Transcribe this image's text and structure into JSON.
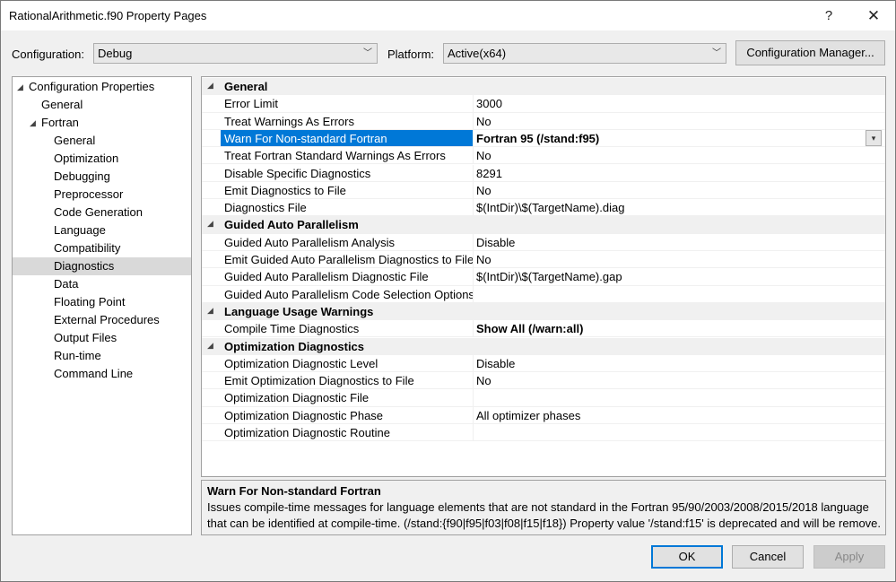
{
  "window": {
    "title": "RationalArithmetic.f90 Property Pages",
    "help_glyph": "?",
    "close_glyph": "✕"
  },
  "config": {
    "configuration_label": "Configuration:",
    "configuration_value": "Debug",
    "platform_label": "Platform:",
    "platform_value": "Active(x64)",
    "manager_button": "Configuration Manager..."
  },
  "tree": [
    {
      "label": "Configuration Properties",
      "toggle": "◢"
    },
    {
      "label": "General"
    },
    {
      "label": "Fortran",
      "toggle": "◢"
    },
    {
      "label": "General"
    },
    {
      "label": "Optimization"
    },
    {
      "label": "Debugging"
    },
    {
      "label": "Preprocessor"
    },
    {
      "label": "Code Generation"
    },
    {
      "label": "Language"
    },
    {
      "label": "Compatibility"
    },
    {
      "label": "Diagnostics",
      "selected": true
    },
    {
      "label": "Data"
    },
    {
      "label": "Floating Point"
    },
    {
      "label": "External Procedures"
    },
    {
      "label": "Output Files"
    },
    {
      "label": "Run-time"
    },
    {
      "label": "Command Line"
    }
  ],
  "grid": {
    "category_toggle": "◢",
    "dropdown_glyph": "▾",
    "categories": [
      {
        "name": "General",
        "props": [
          {
            "name": "Error Limit",
            "value": "3000"
          },
          {
            "name": "Treat Warnings As Errors",
            "value": "No"
          },
          {
            "name": "Warn For Non-standard Fortran",
            "value": "Fortran 95 (/stand:f95)",
            "selected": true
          },
          {
            "name": "Treat Fortran Standard Warnings As Errors",
            "value": "No"
          },
          {
            "name": "Disable Specific Diagnostics",
            "value": "8291"
          },
          {
            "name": "Emit Diagnostics to File",
            "value": "No"
          },
          {
            "name": "Diagnostics File",
            "value": "$(IntDir)\\$(TargetName).diag"
          }
        ]
      },
      {
        "name": "Guided Auto Parallelism",
        "props": [
          {
            "name": "Guided Auto Parallelism Analysis",
            "value": "Disable"
          },
          {
            "name": "Emit Guided Auto Parallelism Diagnostics to File",
            "value": "No"
          },
          {
            "name": "Guided Auto Parallelism Diagnostic File",
            "value": "$(IntDir)\\$(TargetName).gap"
          },
          {
            "name": "Guided Auto Parallelism Code Selection Options",
            "value": ""
          }
        ]
      },
      {
        "name": "Language Usage Warnings",
        "props": [
          {
            "name": "Compile Time Diagnostics",
            "value": "Show All (/warn:all)",
            "bold": true
          }
        ]
      },
      {
        "name": "Optimization Diagnostics",
        "props": [
          {
            "name": "Optimization Diagnostic Level",
            "value": "Disable"
          },
          {
            "name": "Emit Optimization Diagnostics to File",
            "value": "No"
          },
          {
            "name": "Optimization Diagnostic File",
            "value": ""
          },
          {
            "name": "Optimization Diagnostic Phase",
            "value": "All optimizer phases"
          },
          {
            "name": "Optimization Diagnostic Routine",
            "value": ""
          }
        ]
      }
    ]
  },
  "description": {
    "title": "Warn For Non-standard Fortran",
    "line1": "Issues compile-time messages for language elements that are not standard in the Fortran 95/90/2003/2008/2015/2018 language",
    "line2": "that can be identified at compile-time. (/stand:{f90|f95|f03|f08|f15|f18}) Property value '/stand:f15' is deprecated and will be remove..."
  },
  "buttons": {
    "ok": "OK",
    "cancel": "Cancel",
    "apply": "Apply"
  }
}
